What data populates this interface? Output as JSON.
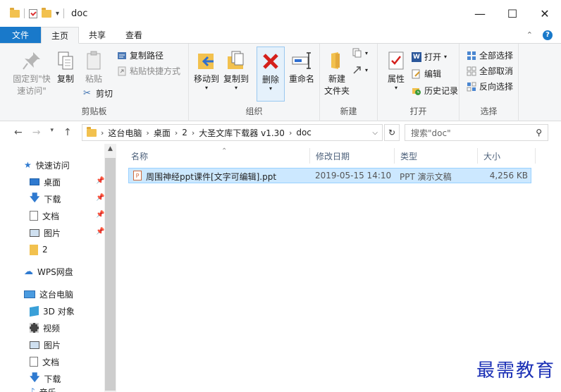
{
  "titlebar": {
    "title": "doc",
    "minimize": "—",
    "maximize": "☐",
    "close": "✕"
  },
  "tabs": {
    "file": "文件",
    "home": "主页",
    "share": "共享",
    "view": "查看"
  },
  "ribbon": {
    "clipboard": {
      "label": "剪贴板",
      "pin": "固定到\"快速访问\"",
      "copy": "复制",
      "paste": "粘贴",
      "copy_path": "复制路径",
      "paste_shortcut": "粘贴快捷方式",
      "cut": "剪切"
    },
    "organize": {
      "label": "组织",
      "move_to": "移动到",
      "copy_to": "复制到",
      "delete": "删除",
      "rename": "重命名"
    },
    "new": {
      "label": "新建",
      "new_folder": "新建\n文件夹"
    },
    "open": {
      "label": "打开",
      "properties": "属性",
      "open": "打开",
      "edit": "编辑",
      "history": "历史记录"
    },
    "select": {
      "label": "选择",
      "select_all": "全部选择",
      "select_none": "全部取消",
      "invert": "反向选择"
    }
  },
  "address": {
    "crumbs": [
      "这台电脑",
      "桌面",
      "2",
      "大圣文库下载器 v1.30",
      "doc"
    ],
    "search_placeholder": "搜索\"doc\""
  },
  "sidebar": {
    "quick_access": "快速访问",
    "items": [
      {
        "label": "桌面"
      },
      {
        "label": "下载"
      },
      {
        "label": "文档"
      },
      {
        "label": "图片"
      },
      {
        "label": "2"
      }
    ],
    "wps": "WPS网盘",
    "this_pc": "这台电脑",
    "pc_items": [
      {
        "label": "3D 对象"
      },
      {
        "label": "视频"
      },
      {
        "label": "图片"
      },
      {
        "label": "文档"
      },
      {
        "label": "下载"
      },
      {
        "label": "音乐"
      }
    ]
  },
  "files": {
    "columns": {
      "name": "名称",
      "date": "修改日期",
      "type": "类型",
      "size": "大小"
    },
    "rows": [
      {
        "name": "周围神经ppt课件[文字可编辑].ppt",
        "date": "2019-05-15 14:10",
        "type": "PPT 演示文稿",
        "size": "4,256 KB"
      }
    ]
  },
  "watermark": "最需教育",
  "colors": {
    "accent": "#1979ca",
    "selection": "#cce8ff",
    "folder": "#f2c14e",
    "delete_red": "#d4201c"
  }
}
